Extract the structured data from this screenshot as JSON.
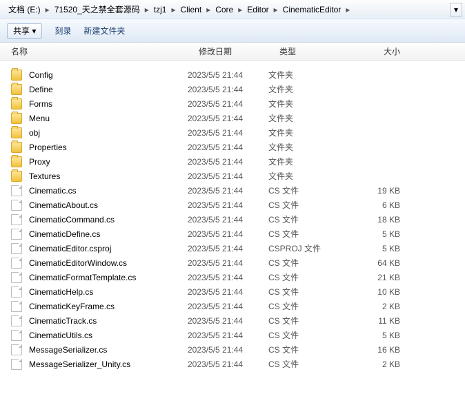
{
  "breadcrumb": [
    "文档 (E:)",
    "71520_天之禁全套源码",
    "tzj1",
    "Client",
    "Core",
    "Editor",
    "CinematicEditor"
  ],
  "toolbar": {
    "share": "共享 ▾",
    "burn": "刻录",
    "newfolder": "新建文件夹"
  },
  "columns": {
    "name": "名称",
    "date": "修改日期",
    "type": "类型",
    "size": "大小"
  },
  "files": [
    {
      "icon": "folder",
      "name": "Config",
      "date": "2023/5/5 21:44",
      "type": "文件夹",
      "size": ""
    },
    {
      "icon": "folder",
      "name": "Define",
      "date": "2023/5/5 21:44",
      "type": "文件夹",
      "size": ""
    },
    {
      "icon": "folder",
      "name": "Forms",
      "date": "2023/5/5 21:44",
      "type": "文件夹",
      "size": ""
    },
    {
      "icon": "folder",
      "name": "Menu",
      "date": "2023/5/5 21:44",
      "type": "文件夹",
      "size": ""
    },
    {
      "icon": "folder",
      "name": "obj",
      "date": "2023/5/5 21:44",
      "type": "文件夹",
      "size": ""
    },
    {
      "icon": "folder",
      "name": "Properties",
      "date": "2023/5/5 21:44",
      "type": "文件夹",
      "size": ""
    },
    {
      "icon": "folder",
      "name": "Proxy",
      "date": "2023/5/5 21:44",
      "type": "文件夹",
      "size": ""
    },
    {
      "icon": "folder",
      "name": "Textures",
      "date": "2023/5/5 21:44",
      "type": "文件夹",
      "size": ""
    },
    {
      "icon": "file",
      "name": "Cinematic.cs",
      "date": "2023/5/5 21:44",
      "type": "CS 文件",
      "size": "19 KB"
    },
    {
      "icon": "file",
      "name": "CinematicAbout.cs",
      "date": "2023/5/5 21:44",
      "type": "CS 文件",
      "size": "6 KB"
    },
    {
      "icon": "file",
      "name": "CinematicCommand.cs",
      "date": "2023/5/5 21:44",
      "type": "CS 文件",
      "size": "18 KB"
    },
    {
      "icon": "file",
      "name": "CinematicDefine.cs",
      "date": "2023/5/5 21:44",
      "type": "CS 文件",
      "size": "5 KB"
    },
    {
      "icon": "file",
      "name": "CinematicEditor.csproj",
      "date": "2023/5/5 21:44",
      "type": "CSPROJ 文件",
      "size": "5 KB"
    },
    {
      "icon": "file",
      "name": "CinematicEditorWindow.cs",
      "date": "2023/5/5 21:44",
      "type": "CS 文件",
      "size": "64 KB"
    },
    {
      "icon": "file",
      "name": "CinematicFormatTemplate.cs",
      "date": "2023/5/5 21:44",
      "type": "CS 文件",
      "size": "21 KB"
    },
    {
      "icon": "file",
      "name": "CinematicHelp.cs",
      "date": "2023/5/5 21:44",
      "type": "CS 文件",
      "size": "10 KB"
    },
    {
      "icon": "file",
      "name": "CinematicKeyFrame.cs",
      "date": "2023/5/5 21:44",
      "type": "CS 文件",
      "size": "2 KB"
    },
    {
      "icon": "file",
      "name": "CinematicTrack.cs",
      "date": "2023/5/5 21:44",
      "type": "CS 文件",
      "size": "11 KB"
    },
    {
      "icon": "file",
      "name": "CinematicUtils.cs",
      "date": "2023/5/5 21:44",
      "type": "CS 文件",
      "size": "5 KB"
    },
    {
      "icon": "file",
      "name": "MessageSerializer.cs",
      "date": "2023/5/5 21:44",
      "type": "CS 文件",
      "size": "16 KB"
    },
    {
      "icon": "file",
      "name": "MessageSerializer_Unity.cs",
      "date": "2023/5/5 21:44",
      "type": "CS 文件",
      "size": "2 KB"
    }
  ]
}
